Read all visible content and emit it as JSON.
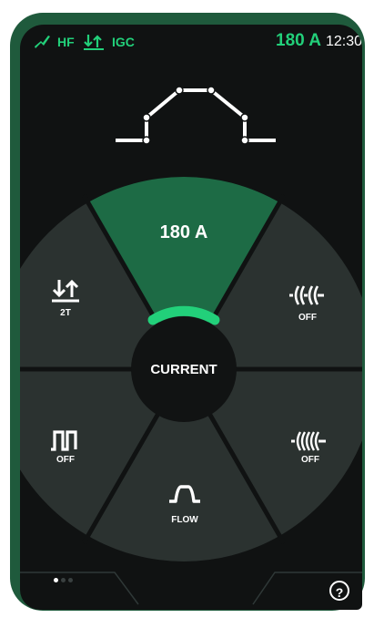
{
  "status": {
    "hf_label": "HF",
    "igc_label": "IGC",
    "current_value": "180 A",
    "time": "12:30"
  },
  "wheel": {
    "current_segment_value": "180 A",
    "center_label": "CURRENT",
    "trigger_mode": "2T",
    "pulse_state": "OFF",
    "top_right_state": "OFF",
    "bottom_right_state": "OFF",
    "flow_label": "FLOW"
  },
  "footer": {
    "help_symbol": "?",
    "page_indicator": {
      "pages": 3,
      "active": 1
    }
  },
  "colors": {
    "accent": "#22d07a",
    "active_segment": "#1d6b45",
    "segment": "#2b3230",
    "background": "#101212",
    "frame": "#1f5a3c"
  },
  "icons": [
    "torch-icon",
    "trigger-mode-icon",
    "pulse-icon",
    "arc-wave-icon",
    "arc-wave-dense-icon",
    "gas-flow-icon",
    "weld-curve-icon",
    "help-icon"
  ]
}
